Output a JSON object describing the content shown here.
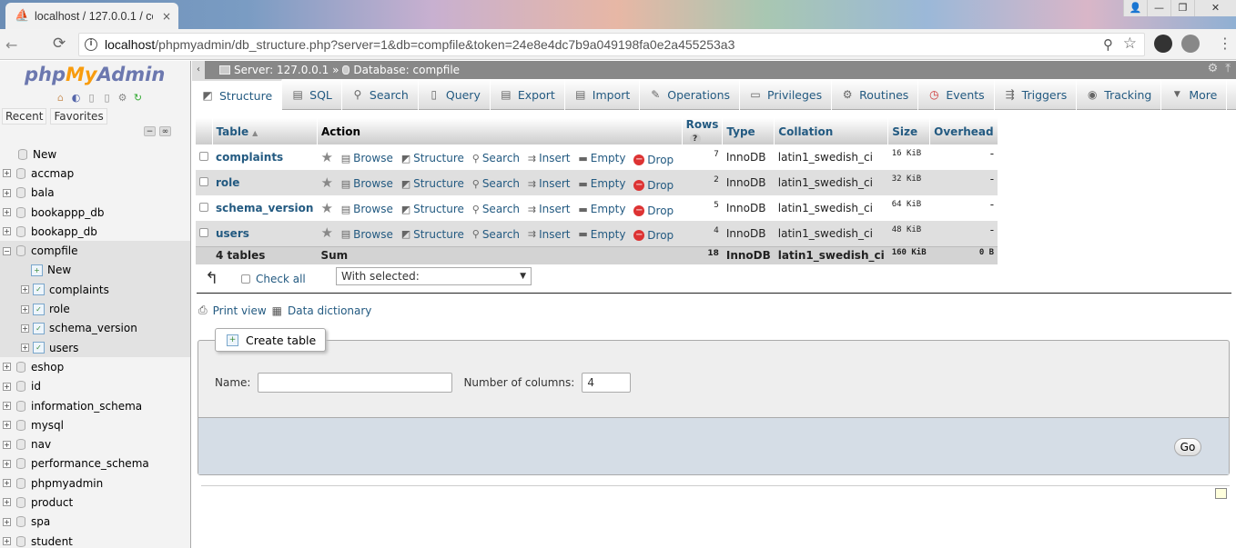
{
  "browser": {
    "tab_title": "localhost / 127.0.0.1 / co",
    "tab_close": "×",
    "url_host": "localhost",
    "url_path": "/phpmyadmin/db_structure.php?server=1&db=compfile&token=24e8e4dc7b9a049198fa0e2a455253a3",
    "back_glyph": "←",
    "reload_glyph": "⟳",
    "zoom_glyph": "⚲",
    "star_glyph": "☆",
    "info_glyph": "i",
    "menu_glyph": "⋮",
    "win_user": "👤",
    "win_min": "—",
    "win_max": "❐",
    "win_close": "✕"
  },
  "nav": {
    "logo_php": "php",
    "logo_my": "My",
    "logo_admin": "Admin",
    "tab_recent": "Recent",
    "tab_favorites": "Favorites",
    "collapse_all": "−",
    "link_glyph": "∞",
    "new_label": "New",
    "databases": [
      "accmap",
      "bala",
      "bookappp_db",
      "bookapp_db"
    ],
    "active_db": "compfile",
    "active_children": [
      "New",
      "complaints",
      "role",
      "schema_version",
      "users"
    ],
    "databases_after": [
      "eshop",
      "id",
      "information_schema",
      "mysql",
      "nav",
      "performance_schema",
      "phpmyadmin",
      "product",
      "spa",
      "student"
    ]
  },
  "serverbar": {
    "collapse": "‹",
    "server": "Server: 127.0.0.1 »",
    "database": "Database: compfile",
    "settings_glyph": "⚙",
    "collapse_glyph": "⤒"
  },
  "topmenu": [
    {
      "label": "Structure",
      "icon": "structure-icon",
      "glyph": "◩",
      "active": true
    },
    {
      "label": "SQL",
      "icon": "sql-icon",
      "glyph": "▤"
    },
    {
      "label": "Search",
      "icon": "search-icon",
      "glyph": "⚲"
    },
    {
      "label": "Query",
      "icon": "query-icon",
      "glyph": "▯"
    },
    {
      "label": "Export",
      "icon": "export-icon",
      "glyph": "▤"
    },
    {
      "label": "Import",
      "icon": "import-icon",
      "glyph": "▤"
    },
    {
      "label": "Operations",
      "icon": "wrench-icon",
      "glyph": "✎"
    },
    {
      "label": "Privileges",
      "icon": "privileges-icon",
      "glyph": "▭"
    },
    {
      "label": "Routines",
      "icon": "routines-icon",
      "glyph": "⚙"
    },
    {
      "label": "Events",
      "icon": "events-icon",
      "glyph": "◷"
    },
    {
      "label": "Triggers",
      "icon": "triggers-icon",
      "glyph": "⇶"
    },
    {
      "label": "Tracking",
      "icon": "tracking-icon",
      "glyph": "◉"
    },
    {
      "label": "More",
      "icon": "more-icon",
      "glyph": "▼"
    }
  ],
  "table": {
    "headers": {
      "table": "Table",
      "action": "Action",
      "rows": "Rows",
      "type": "Type",
      "collation": "Collation",
      "size": "Size",
      "overhead": "Overhead"
    },
    "help_glyph": "?",
    "sort_glyph": "▲",
    "actions": {
      "browse": "Browse",
      "structure": "Structure",
      "search": "Search",
      "insert": "Insert",
      "empty": "Empty",
      "drop": "Drop"
    },
    "action_glyphs": {
      "favorite": "★",
      "browse": "▤",
      "structure": "◩",
      "search": "⚲",
      "insert": "⇉",
      "empty": "▬",
      "drop": "−"
    },
    "rows": [
      {
        "name": "complaints",
        "rows": "7",
        "type": "InnoDB",
        "collation": "latin1_swedish_ci",
        "size": "16 KiB",
        "overhead": "-"
      },
      {
        "name": "role",
        "rows": "2",
        "type": "InnoDB",
        "collation": "latin1_swedish_ci",
        "size": "32 KiB",
        "overhead": "-"
      },
      {
        "name": "schema_version",
        "rows": "5",
        "type": "InnoDB",
        "collation": "latin1_swedish_ci",
        "size": "64 KiB",
        "overhead": "-"
      },
      {
        "name": "users",
        "rows": "4",
        "type": "InnoDB",
        "collation": "latin1_swedish_ci",
        "size": "48 KiB",
        "overhead": "-"
      }
    ],
    "footer": {
      "count": "4 tables",
      "sum": "Sum",
      "rows": "18",
      "type": "InnoDB",
      "collation": "latin1_swedish_ci",
      "size": "160 KiB",
      "overhead": "0 B"
    }
  },
  "bulk": {
    "arrow_glyph": "↰",
    "check_all": "Check all",
    "with_selected": "With selected:",
    "dropdown_glyph": "▼"
  },
  "links": {
    "print_view": "Print view",
    "data_dictionary": "Data dictionary",
    "print_glyph": "⎙",
    "dict_glyph": "▦"
  },
  "create_table": {
    "legend": "Create table",
    "plus_glyph": "+",
    "name_label": "Name:",
    "name_value": "",
    "columns_label": "Number of columns:",
    "columns_value": "4",
    "go": "Go"
  }
}
